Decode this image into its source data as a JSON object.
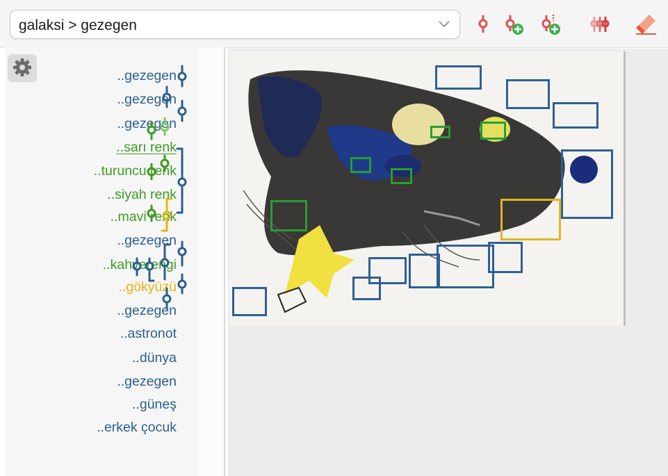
{
  "toolbar": {
    "path": "galaksi > gezegen",
    "icons": [
      "tag-icon",
      "add-tag-icon",
      "add-child-tag-icon",
      "delete-tags-icon",
      "eraser-icon"
    ]
  },
  "sidebar": {
    "tags": [
      {
        "label": "..gezegen",
        "color": "#2b5f8e"
      },
      {
        "label": "..gezegen",
        "color": "#2b5f8e"
      },
      {
        "label": "..gezegen",
        "color": "#2b5f8e"
      },
      {
        "label": "..sarı renk",
        "color": "#3d9b21",
        "underlined": true
      },
      {
        "label": "..turuncu renk",
        "color": "#3d9b21"
      },
      {
        "label": "..siyah renk",
        "color": "#3d9b21"
      },
      {
        "label": "..mavi renk",
        "color": "#3d9b21"
      },
      {
        "label": "..gezegen",
        "color": "#2b5f8e"
      },
      {
        "label": "..kahverengi",
        "color": "#3d9b21"
      },
      {
        "label": "..gökyüzü",
        "color": "#e3b513"
      },
      {
        "label": "..gezegen",
        "color": "#2b5f8e"
      },
      {
        "label": "..astronot",
        "color": "#2b5f8e"
      },
      {
        "label": "..dünya",
        "color": "#2b5f8e"
      },
      {
        "label": "..gezegen",
        "color": "#2b5f8e"
      },
      {
        "label": "..güneş",
        "color": "#2b5f8e"
      },
      {
        "label": "..erkek çocuk",
        "color": "#2b5f8e"
      }
    ]
  },
  "colors": {
    "blue_tag": "#2b5f8e",
    "green_tag": "#3d9b21",
    "yellow_tag": "#e3b513",
    "red_icon": "#d9534f"
  }
}
